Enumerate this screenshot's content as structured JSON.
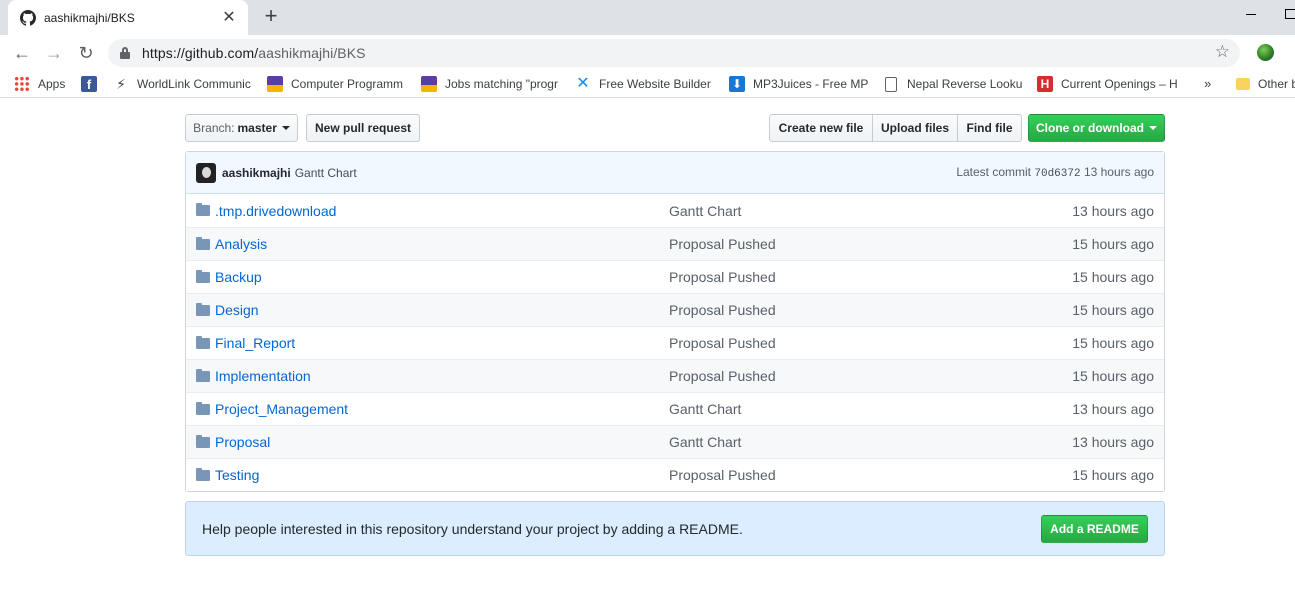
{
  "browser": {
    "tab_title": "aashikmajhi/BKS",
    "url_host": "https://github.com/",
    "url_path": "aashikmajhi/BKS",
    "bookmarks": [
      {
        "label": "Apps",
        "icon": "apps-grid-icon",
        "color": "#4285f4"
      },
      {
        "label": "",
        "icon": "facebook-icon",
        "color": "#3b5998"
      },
      {
        "label": "WorldLink Communic",
        "icon": "lightning-icon",
        "color": "#222222"
      },
      {
        "label": "Computer Programm",
        "icon": "graduation-cap-icon",
        "color": "#5b3fa0"
      },
      {
        "label": "Jobs matching \"progr",
        "icon": "graduation-cap-icon",
        "color": "#5b3fa0"
      },
      {
        "label": "Free Website Builder",
        "icon": "wix-icon",
        "color": "#1e88e5"
      },
      {
        "label": "MP3Juices - Free MP",
        "icon": "download-icon",
        "color": "#1976d2"
      },
      {
        "label": "Nepal Reverse Looku",
        "icon": "page-icon",
        "color": "#ffffff"
      },
      {
        "label": "Current Openings – H",
        "icon": "h-icon",
        "color": "#d32f2f"
      },
      {
        "label": "Other b",
        "icon": "folder-icon",
        "color": "#f9d35b"
      }
    ]
  },
  "repo": {
    "branch_label": "Branch:",
    "branch_name": "master",
    "new_pull_request": "New pull request",
    "create_new_file": "Create new file",
    "upload_files": "Upload files",
    "find_file": "Find file",
    "clone_or_download": "Clone or download",
    "commit": {
      "author": "aashikmajhi",
      "message": "Gantt Chart",
      "latest_label": "Latest commit",
      "sha": "70d6372",
      "age": "13 hours ago"
    },
    "files": [
      {
        "name": ".tmp.drivedownload",
        "message": "Gantt Chart",
        "age": "13 hours ago"
      },
      {
        "name": "Analysis",
        "message": "Proposal Pushed",
        "age": "15 hours ago"
      },
      {
        "name": "Backup",
        "message": "Proposal Pushed",
        "age": "15 hours ago"
      },
      {
        "name": "Design",
        "message": "Proposal Pushed",
        "age": "15 hours ago"
      },
      {
        "name": "Final_Report",
        "message": "Proposal Pushed",
        "age": "15 hours ago"
      },
      {
        "name": "Implementation",
        "message": "Proposal Pushed",
        "age": "15 hours ago"
      },
      {
        "name": "Project_Management",
        "message": "Gantt Chart",
        "age": "13 hours ago"
      },
      {
        "name": "Proposal",
        "message": "Gantt Chart",
        "age": "13 hours ago"
      },
      {
        "name": "Testing",
        "message": "Proposal Pushed",
        "age": "15 hours ago"
      }
    ],
    "readme_prompt": "Help people interested in this repository understand your project by adding a README.",
    "add_readme": "Add a README"
  }
}
